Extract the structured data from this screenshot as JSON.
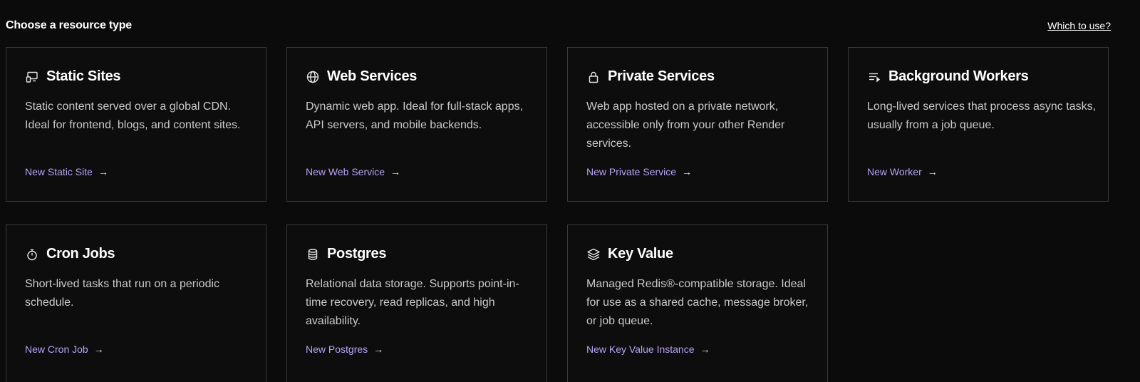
{
  "header": {
    "title": "Choose a resource type",
    "which_link": "Which to use?"
  },
  "cards": [
    {
      "icon": "monitor-icon",
      "title": "Static Sites",
      "description": "Static content served over a global CDN. Ideal for frontend, blogs, and content sites.",
      "link": "New Static Site"
    },
    {
      "icon": "globe-icon",
      "title": "Web Services",
      "description": "Dynamic web app. Ideal for full-stack apps, API servers, and mobile backends.",
      "link": "New Web Service"
    },
    {
      "icon": "lock-icon",
      "title": "Private Services",
      "description": "Web app hosted on a private network, accessible only from your other Render services.",
      "link": "New Private Service"
    },
    {
      "icon": "list-arrow-icon",
      "title": "Background Workers",
      "description": "Long-lived services that process async tasks, usually from a job queue.",
      "link": "New Worker"
    },
    {
      "icon": "stopwatch-icon",
      "title": "Cron Jobs",
      "description": "Short-lived tasks that run on a periodic schedule.",
      "link": "New Cron Job"
    },
    {
      "icon": "database-icon",
      "title": "Postgres",
      "description": "Relational data storage. Supports point-in-time recovery, read replicas, and high availability.",
      "link": "New Postgres"
    },
    {
      "icon": "layers-icon",
      "title": "Key Value",
      "description": "Managed Redis®-compatible storage. Ideal for use as a shared cache, message broker, or job queue.",
      "link": "New Key Value Instance"
    }
  ],
  "arrow_glyph": "→",
  "colors": {
    "background": "#0b0b0b",
    "card_border": "#3a3a3a",
    "link_accent": "#b8a3f5"
  }
}
